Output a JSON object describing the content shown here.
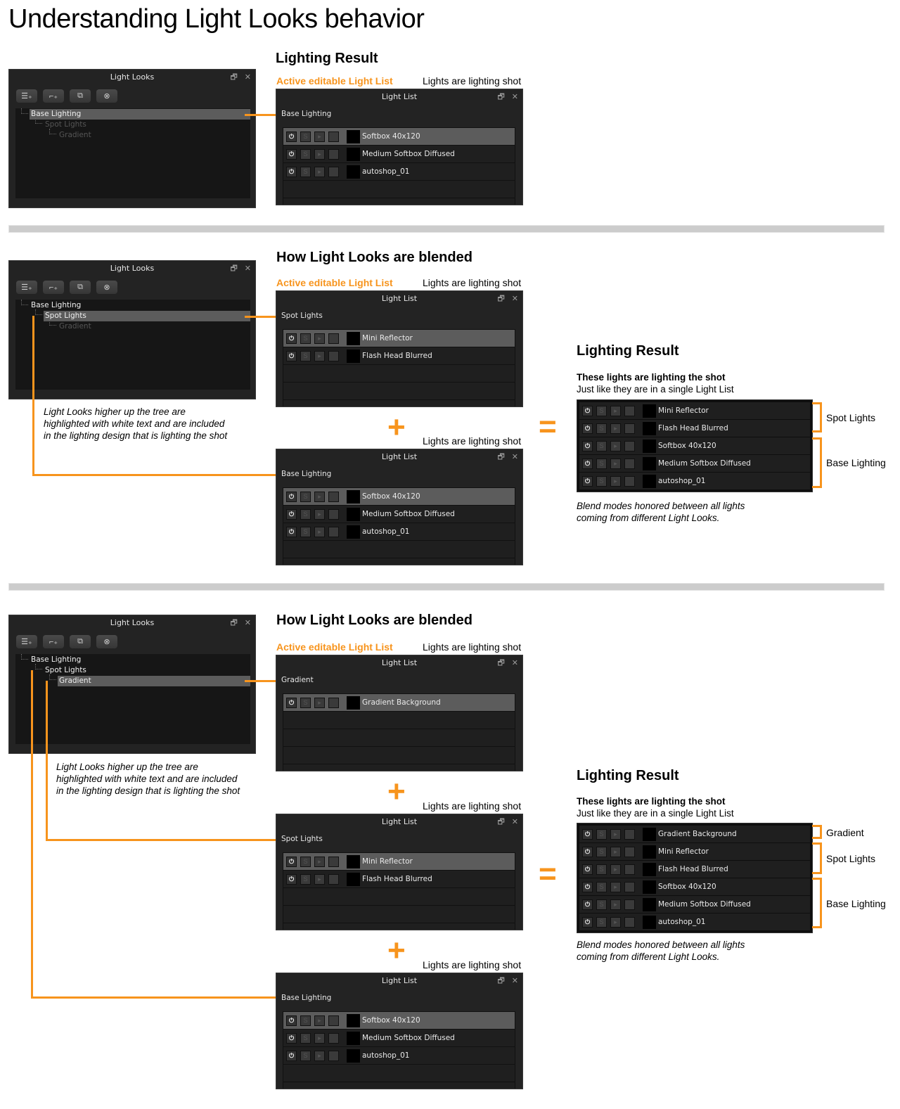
{
  "page_title": "Understanding Light Looks behavior",
  "accent_color": "#f7941d",
  "labels": {
    "active_editable": "Active editable Light List",
    "lights_lighting_shot": "Lights are lighting shot",
    "light_looks_panel_title": "Light Looks",
    "light_list_panel_title": "Light List",
    "restore_icon": "🗗",
    "close_icon": "✕",
    "plus": "+",
    "equals": "="
  },
  "toolbar": [
    {
      "name": "add-light-look",
      "glyph": "☰₊"
    },
    {
      "name": "add-child-light-look",
      "glyph": "⌐₊"
    },
    {
      "name": "duplicate-light-look",
      "glyph": "⧉"
    },
    {
      "name": "delete-light-look",
      "glyph": "⊗"
    }
  ],
  "tree_items": [
    "Base Lighting",
    "Spot Lights",
    "Gradient"
  ],
  "lights": {
    "softbox": "Softbox 40x120",
    "medium": "Medium Softbox Diffused",
    "autoshop": "autoshop_01",
    "mini": "Mini Reflector",
    "flash": "Flash Head Blurred",
    "gradient_bg": "Gradient Background"
  },
  "row_controls": {
    "power": "⏻",
    "solo": "S",
    "select": "▸",
    "lock": "🔒"
  },
  "section1": {
    "heading": "Lighting Result",
    "active_look": "Base Lighting"
  },
  "section2": {
    "heading": "How Light Looks are blended",
    "active_look": "Spot Lights",
    "parent_look": "Base Lighting",
    "note_lines": [
      "Light Looks higher up the tree are",
      "highlighted with white text and are included",
      "in the lighting design that is lighting the shot"
    ],
    "result_heading": "Lighting Result",
    "result_bold": "These lights are lighting the shot",
    "result_sub": "Just like they are in a single Light List",
    "result_groups": [
      "Spot Lights",
      "Base Lighting"
    ],
    "blend_note": [
      "Blend modes honored between all lights",
      "coming from different Light Looks."
    ]
  },
  "section3": {
    "heading": "How Light Looks are blended",
    "active_look": "Gradient",
    "parent_looks": [
      "Spot Lights",
      "Base Lighting"
    ],
    "note_lines": [
      "Light Looks higher up the tree are",
      "highlighted with white text and are included",
      "in the lighting design that is lighting the shot"
    ],
    "result_heading": "Lighting Result",
    "result_bold": "These lights are lighting the shot",
    "result_sub": "Just like they are in a single Light List",
    "result_groups": [
      "Gradient",
      "Spot Lights",
      "Base Lighting"
    ],
    "blend_note": [
      "Blend modes honored between all lights",
      "coming from different Light Looks."
    ]
  }
}
